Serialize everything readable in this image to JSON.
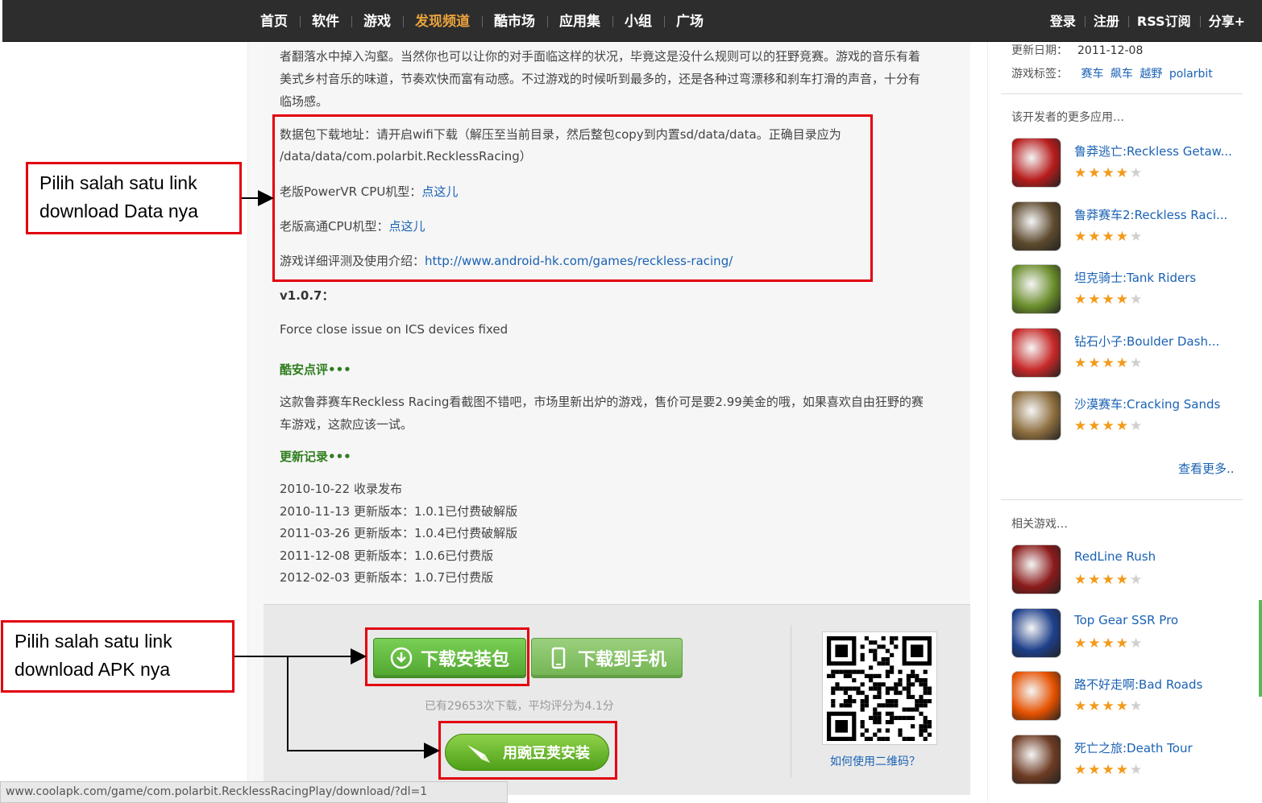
{
  "nav": {
    "items": [
      "首页",
      "软件",
      "游戏",
      "发现频道",
      "酷市场",
      "应用集",
      "小组",
      "广场"
    ],
    "active": "发现频道",
    "right": [
      "登录",
      "注册",
      "RSS订阅",
      "分享+"
    ]
  },
  "content": {
    "intro_lines": [
      "者翻落水中掉入沟壑。当然你也可以让你的对手面临这样的状况，毕竟这是没什么规则可以的狂野竞赛。游戏的音乐有着",
      "美式乡村音乐的味道，节奏欢快而富有动感。不过游戏的时候听到最多的，还是各种过弯漂移和刹车打滑的声音，十分有",
      "临场感。"
    ],
    "data_pkg_line1": "数据包下载地址：请开启wifi下载（解压至当前目录，然后整包copy到内置sd/data/data。正确目录应为",
    "data_pkg_line2": "/data/data/com.polarbit.RecklessRacing）",
    "powervr_label": "老版PowerVR CPU机型：",
    "powervr_link": "点这儿",
    "qualcomm_label": "老版高通CPU机型：",
    "qualcomm_link": "点这儿",
    "review_label": "游戏详细评测及使用介绍：",
    "review_url": "http://www.android-hk.com/games/reckless-racing/",
    "version": "v1.0.7：",
    "fix_note": "Force close issue on ICS devices fixed",
    "coolapk_review_title": "酷安点评•••",
    "coolapk_review_lines": [
      "这款鲁莽赛车Reckless Racing看截图不错吧，市场里新出炉的游戏，售价可是要2.99美金的哦，如果喜欢自由狂野的赛",
      "车游戏，这款应该一试。"
    ],
    "changelog_title": "更新记录•••",
    "changelog": [
      "2010-10-22 收录发布",
      "2010-11-13 更新版本：1.0.1已付费破解版",
      "2011-03-26 更新版本：1.0.4已付费破解版",
      "2011-12-08 更新版本：1.0.6已付费版",
      "2012-02-03 更新版本：1.0.7已付费版"
    ]
  },
  "download": {
    "apk_button": "下载安装包",
    "phone_button": "下载到手机",
    "stats": "已有29653次下载，平均评分为4.1分",
    "wandoujia_button": "用豌豆荚安装",
    "qr_help": "如何使用二维码？"
  },
  "status_url": "www.coolapk.com/game/com.polarbit.RecklessRacingPlay/download/?dl=1",
  "sidebar": {
    "update_label": "更新日期：",
    "update_value": "2011-12-08",
    "tags_label": "游戏标签：",
    "tags": [
      "赛车",
      "飙车",
      "越野",
      "polarbit"
    ],
    "dev_heading": "该开发者的更多应用…",
    "dev_apps": [
      {
        "name": "鲁莽逃亡:Reckless Getaw...",
        "rating": 4,
        "color": "#b71c1c"
      },
      {
        "name": "鲁莽赛车2:Reckless Raci...",
        "rating": 4,
        "color": "#5d4a2e"
      },
      {
        "name": "坦克骑士:Tank Riders",
        "rating": 4,
        "color": "#6a8d2b"
      },
      {
        "name": "钻石小子:Boulder Dash...",
        "rating": 4,
        "color": "#c62828"
      },
      {
        "name": "沙漠赛车:Cracking Sands",
        "rating": 4,
        "color": "#8d6e3f"
      }
    ],
    "more_link": "查看更多..",
    "related_heading": "相关游戏…",
    "related_apps": [
      {
        "name": "RedLine Rush",
        "rating": 4,
        "color": "#8b1a1a"
      },
      {
        "name": "Top Gear SSR Pro",
        "rating": 4,
        "color": "#1e3f8a"
      },
      {
        "name": "路不好走啊:Bad Roads",
        "rating": 4,
        "color": "#e65100"
      },
      {
        "name": "死亡之旅:Death Tour",
        "rating": 4,
        "color": "#6d3b23"
      }
    ]
  },
  "annotations": {
    "data_callout": "Pilih salah satu link download Data nya",
    "apk_callout": "Pilih salah satu link download APK nya",
    "box_color": "#e3000f"
  }
}
